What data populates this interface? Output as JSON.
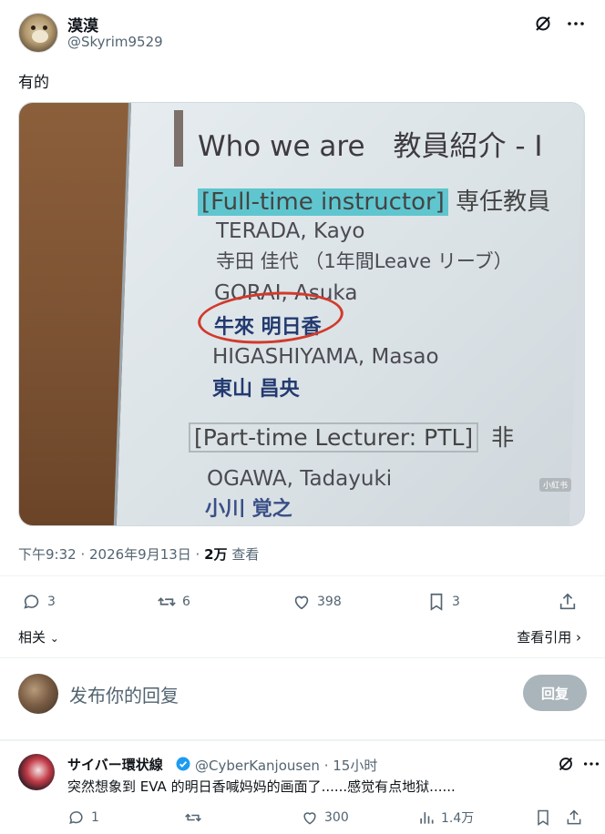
{
  "post": {
    "display_name": "漠漠",
    "handle": "@Skyrim9529",
    "text": "有的",
    "timestamp": "下午9:32 · 2026年9月13日 ·",
    "views_count": "2万",
    "views_label": "查看",
    "replies": "3",
    "reposts": "6",
    "likes": "398",
    "bookmarks": "3"
  },
  "image": {
    "title": "Who we are　教員紹介 - I",
    "section1": "[Full-time instructor]",
    "section1_jp": "専任教員",
    "name1": "TERADA, Kayo",
    "name1_jp": "寺田 佳代 （1年間Leave リーブ）",
    "name2": "GORAI, Asuka",
    "name2_jp": "牛來 明日香",
    "name3": "HIGASHIYAMA, Masao",
    "name3_jp": "東山 昌央",
    "section2": "[Part-time Lecturer: PTL]",
    "section2_jp": "非",
    "name4": "OGAWA, Tadayuki",
    "name4_jp": "小川 覚之",
    "watermark": "小紅书"
  },
  "links": {
    "related": "相关",
    "view_quotes": "查看引用"
  },
  "reply_box": {
    "placeholder": "发布你的回复",
    "button": "回复"
  },
  "comment": {
    "display_name": "サイバー環状線",
    "handle_time": "@CyberKanjousen · 15小时",
    "text": "突然想象到 EVA 的明日香喊妈妈的画面了......感觉有点地狱......",
    "replies": "1",
    "likes": "300",
    "views": "1.4万"
  },
  "colors": {
    "secondary_text": "#536471",
    "reply_button_disabled": "#aab4bb",
    "verified_blue": "#1d9bf0",
    "circle_red": "#d23a2b"
  }
}
